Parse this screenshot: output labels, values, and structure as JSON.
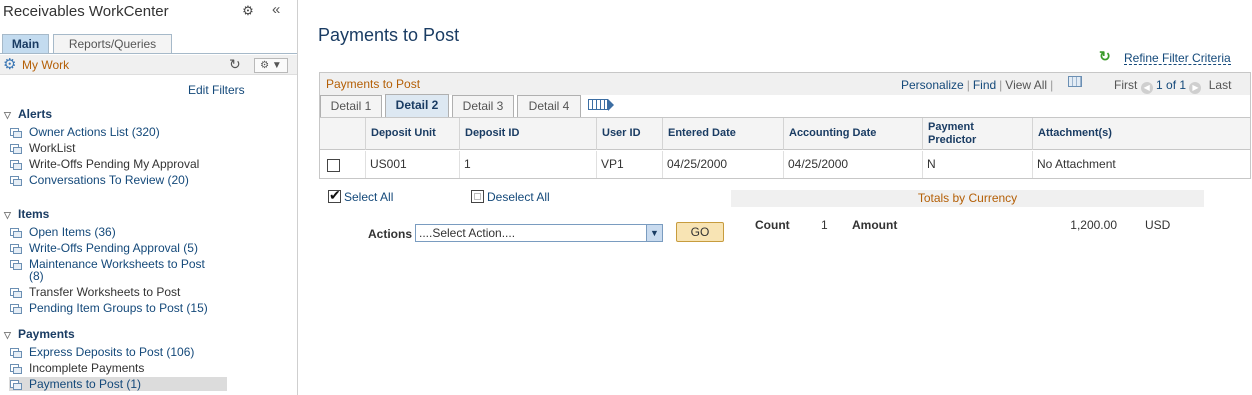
{
  "workcenter": {
    "title": "Receivables WorkCenter",
    "tabs": [
      {
        "label": "Main"
      },
      {
        "label": "Reports/Queries"
      }
    ],
    "mywork_label": "My Work",
    "edit_filters": "Edit Filters",
    "sections": [
      {
        "title": "Alerts",
        "items": [
          {
            "label": "Owner Actions List (320)"
          },
          {
            "label": "WorkList"
          },
          {
            "label": "Write-Offs Pending My Approval"
          },
          {
            "label": "Conversations To Review (20)"
          }
        ]
      },
      {
        "title": "Items",
        "items": [
          {
            "label": "Open Items (36)"
          },
          {
            "label": "Write-Offs Pending Approval (5)"
          },
          {
            "label": "Maintenance Worksheets to Post (8)"
          },
          {
            "label": "Transfer Worksheets to Post"
          },
          {
            "label": "Pending Item Groups to Post (15)"
          }
        ]
      },
      {
        "title": "Payments",
        "items": [
          {
            "label": "Express Deposits to Post (106)"
          },
          {
            "label": "Incomplete Payments"
          },
          {
            "label": "Payments to Post (1)"
          }
        ]
      }
    ]
  },
  "page": {
    "title": "Payments to Post",
    "refine_filter": "Refine Filter Criteria"
  },
  "grid": {
    "title": "Payments to Post",
    "nav": {
      "personalize": "Personalize",
      "find": "Find",
      "view_all": "View All"
    },
    "pager": {
      "first": "First",
      "range": "1 of 1",
      "last": "Last"
    },
    "detail_tabs": [
      {
        "label": "Detail 1",
        "active": false
      },
      {
        "label": "Detail 2",
        "active": true
      },
      {
        "label": "Detail 3",
        "active": false
      },
      {
        "label": "Detail 4",
        "active": false
      }
    ],
    "columns": [
      "Deposit Unit",
      "Deposit ID",
      "User ID",
      "Entered Date",
      "Accounting Date",
      "Payment Predictor",
      "Attachment(s)"
    ],
    "rows": [
      {
        "deposit_unit": "US001",
        "deposit_id": "1",
        "user_id": "VP1",
        "entered_date": "04/25/2000",
        "accounting_date": "04/25/2000",
        "payment_predictor": "N",
        "attachments": "No Attachment",
        "checked": false
      }
    ]
  },
  "selection": {
    "select_all": "Select All",
    "deselect_all": "Deselect All"
  },
  "actions": {
    "label": "Actions",
    "selected": "....Select Action....",
    "go": "GO"
  },
  "totals": {
    "title": "Totals by Currency",
    "count_label": "Count",
    "count": "1",
    "amount_label": "Amount",
    "amount": "1,200.00",
    "currency": "USD"
  },
  "colors": {
    "accent": "#1a3c63",
    "link": "#14497a",
    "section_title": "#b45f06",
    "go_button": "#f8e4b4"
  }
}
